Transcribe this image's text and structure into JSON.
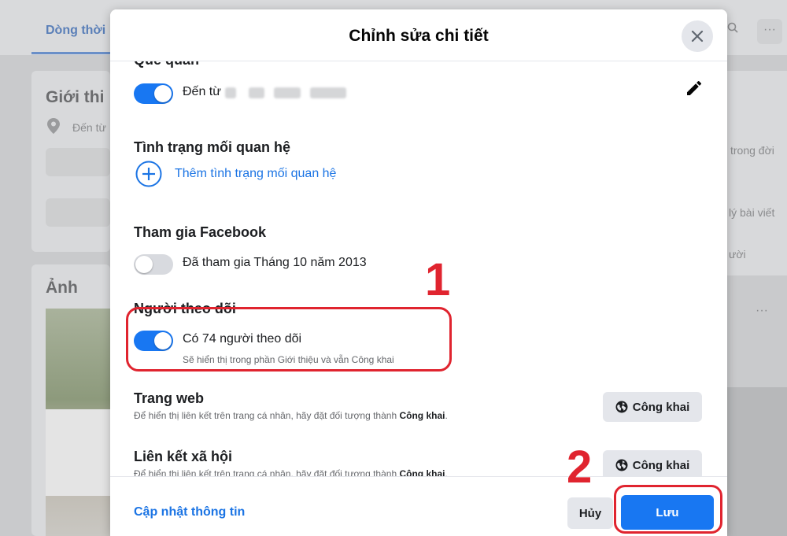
{
  "background": {
    "tab_label": "Dòng thời",
    "intro_heading": "Giới thi",
    "from_text": "Đến từ",
    "photos_heading": "Ảnh",
    "right_text_1": "trong đời",
    "right_text_2": "lý bài viết",
    "right_text_3": "ười",
    "more_dots": "···"
  },
  "modal": {
    "title": "Chỉnh sửa chi tiết",
    "close_icon": "close-icon",
    "hometown": {
      "heading_partial": "Quê quán",
      "toggle_on": true,
      "text": "Đến từ"
    },
    "relationship": {
      "heading": "Tình trạng mối quan hệ",
      "add_link": "Thêm tình trạng mối quan hệ"
    },
    "joined": {
      "heading": "Tham gia Facebook",
      "toggle_on": false,
      "text": "Đã tham gia Tháng 10 năm 2013"
    },
    "followers": {
      "heading": "Người theo dõi",
      "toggle_on": true,
      "text": "Có 74 người theo dõi",
      "sub": "Sẽ hiển thị trong phần Giới thiệu và vẫn Công khai"
    },
    "website": {
      "heading": "Trang web",
      "sub_prefix": "Để hiển thị liên kết trên trang cá nhân, hãy đặt đối tượng thành ",
      "sub_bold": "Công khai",
      "sub_suffix": ".",
      "privacy_button": "Công khai"
    },
    "social_links": {
      "heading": "Liên kết xã hội",
      "sub_prefix": "Để hiển thị liên kết trên trang cá nhân, hãy đặt đối tượng thành ",
      "sub_bold": "Công khai",
      "sub_suffix": ".",
      "privacy_button": "Công khai"
    },
    "footer": {
      "update_link": "Cập nhật thông tin",
      "cancel_label": "Hủy",
      "save_label": "Lưu"
    }
  },
  "annotations": {
    "step_1": "1",
    "step_2": "2",
    "color": "#e0242f"
  },
  "colors": {
    "primary_blue": "#1877f2",
    "link_blue": "#1b74e4",
    "button_grey": "#e4e6eb"
  }
}
